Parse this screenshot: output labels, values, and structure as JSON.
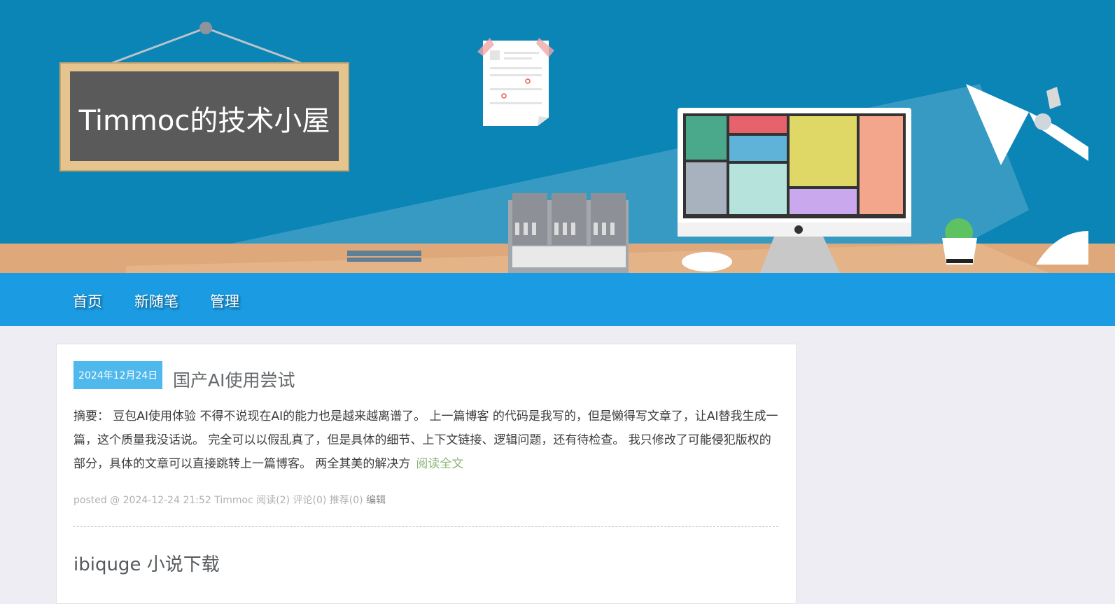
{
  "header": {
    "title": "Timmoc的技术小屋"
  },
  "nav": {
    "items": [
      {
        "label": "首页"
      },
      {
        "label": "新随笔"
      },
      {
        "label": "管理"
      }
    ]
  },
  "posts": [
    {
      "date": "2024年12月24日",
      "title": "国产AI使用尝试",
      "summary": "摘要： 豆包AI使用体验 不得不说现在AI的能力也是越来越离谱了。 上一篇博客 的代码是我写的，但是懒得写文章了，让AI替我生成一篇，这个质量我没话说。 完全可以以假乱真了，但是具体的细节、上下文链接、逻辑问题，还有待检查。 我只修改了可能侵犯版权的部分，具体的文章可以直接跳转上一篇博客。 两全其美的解决方",
      "read_more": "阅读全文",
      "meta": "posted @ 2024-12-24 21:52 Timmoc 阅读(2) 评论(0) 推荐(0)",
      "edit": "编辑"
    },
    {
      "title": "ibiquge 小说下载"
    }
  ],
  "colors": {
    "banner": "#0b84b6",
    "nav": "#1a9be2",
    "date_badge": "#4fb8ec",
    "read_more": "#8fb57a"
  }
}
